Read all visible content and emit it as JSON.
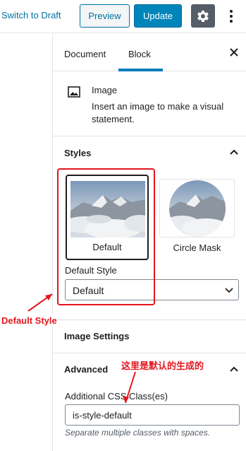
{
  "toolbar": {
    "switch_label": "Switch to Draft",
    "preview_label": "Preview",
    "update_label": "Update",
    "settings_icon": "gear-icon",
    "more_icon": "vertical-ellipsis-icon"
  },
  "sidebar": {
    "tabs": [
      {
        "label": "Document",
        "active": false
      },
      {
        "label": "Block",
        "active": true
      }
    ],
    "close_icon": "close-icon",
    "block": {
      "icon": "image-icon",
      "name": "Image",
      "description": "Insert an image to make a visual statement."
    },
    "styles": {
      "title": "Styles",
      "expanded": true,
      "options": [
        {
          "label": "Default",
          "selected": true
        },
        {
          "label": "Circle Mask",
          "selected": false
        }
      ],
      "default_style_label": "Default Style",
      "default_style_value": "Default"
    },
    "image_settings": {
      "title": "Image Settings",
      "expanded": false
    },
    "advanced": {
      "title": "Advanced",
      "expanded": true,
      "css_class_label": "Additional CSS Class(es)",
      "css_class_value": "is-style-default",
      "help": "Separate multiple classes with spaces."
    }
  },
  "annotations": {
    "label_default_style": "Default Style",
    "label_generated": "这里是默认的生成的",
    "color": "#e4161e"
  },
  "colors": {
    "primary": "#0085ba",
    "link": "#0071a1",
    "tab_accent": "#007cba",
    "settings_bg": "#555d66"
  }
}
